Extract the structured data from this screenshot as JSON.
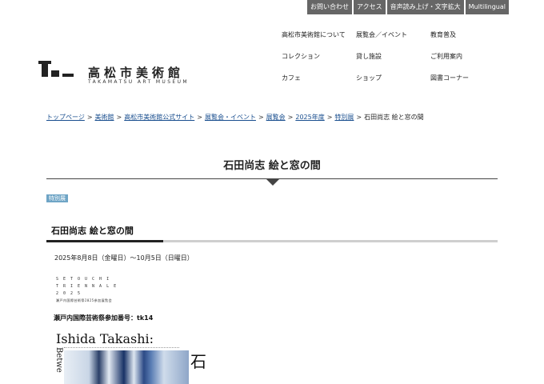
{
  "utility_nav": [
    "お問い合わせ",
    "アクセス",
    "音声読み上げ・文字拡大",
    "Multilingual"
  ],
  "logo": {
    "name": "高松市美術館",
    "sub": "TAKAMATSU ART MUSEUM"
  },
  "global_nav": [
    "高松市美術館について",
    "展覧会／イベント",
    "教育普及",
    "コレクション",
    "貸し施設",
    "ご利用案内",
    "カフェ",
    "ショップ",
    "図書コーナー"
  ],
  "breadcrumb": {
    "links": [
      "トップページ",
      "美術館",
      "高松市美術館公式サイト",
      "展覧会・イベント",
      "展覧会",
      "2025年度",
      "特別展"
    ],
    "separator": ">",
    "current": "石田尚志 絵と窓の間"
  },
  "page_title": "石田尚志 絵と窓の間",
  "category_tag": "特別展",
  "section_heading": "石田尚志 絵と窓の間",
  "date": "2025年8月8日（金曜日）～10月5日（日曜日）",
  "setouchi_logo": {
    "lines": [
      "SETOUCHI",
      "TRIENNALE",
      "2025"
    ],
    "jp": "瀬戸内国際芸術祭2025参加展覧会"
  },
  "entry_number": "瀬戸内国際芸術祭参加番号：tk14",
  "poster": {
    "title": "Ishida Takashi:",
    "vertical_text": "Betwe",
    "kanji": "石"
  },
  "colors": {
    "utility_bg": "#666666",
    "link": "#1a4f8f",
    "tag_bg": "#6fa5c6",
    "rule_dark": "#222222",
    "rule_light": "#cfcfcf"
  }
}
